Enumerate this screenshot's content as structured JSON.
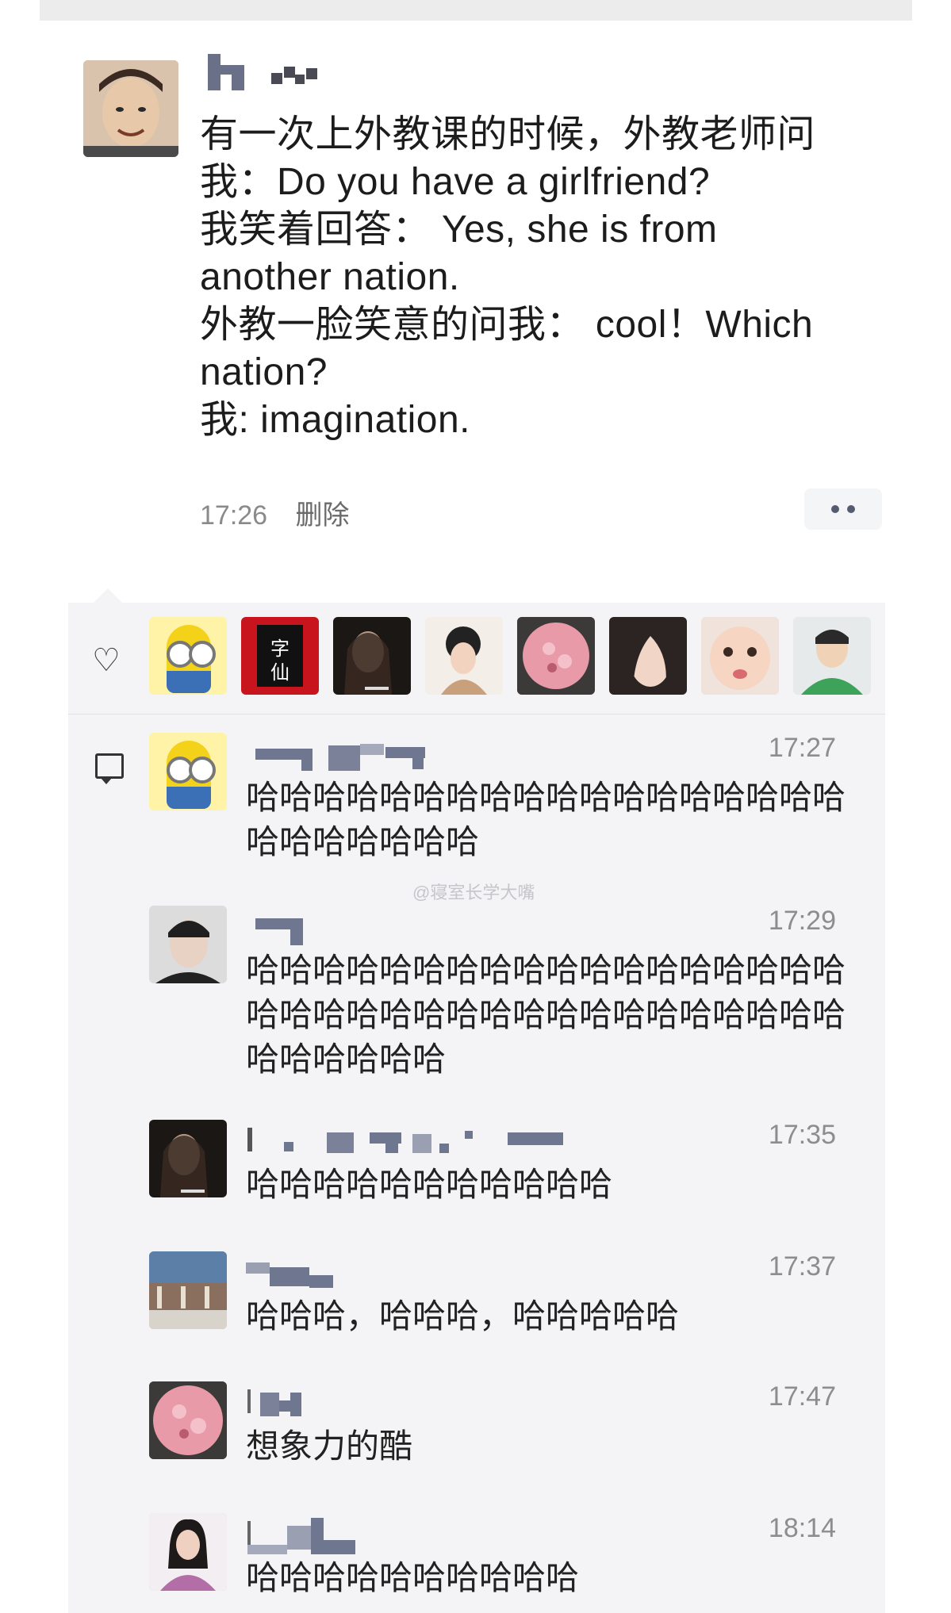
{
  "post": {
    "lines": [
      "有一次上外教课的时候，外教老师问",
      "我：Do you have a girlfriend?",
      "我笑着回答： Yes, she is from",
      "another nation.",
      "外教一脸笑意的问我： cool！Which",
      "nation?",
      "我: imagination."
    ],
    "time": "17:26",
    "delete_label": "删除"
  },
  "likes": {
    "icon": "heart-icon",
    "count_avatars": 8
  },
  "watermark": "@寝室长学大嘴",
  "comments": [
    {
      "time": "17:27",
      "text": "哈哈哈哈哈哈哈哈哈哈哈哈哈哈哈哈哈哈哈哈哈哈哈哈哈"
    },
    {
      "time": "17:29",
      "text": "哈哈哈哈哈哈哈哈哈哈哈哈哈哈哈哈哈哈哈哈哈哈哈哈哈哈哈哈哈哈哈哈哈哈哈哈哈哈哈哈哈哈"
    },
    {
      "time": "17:35",
      "text": "哈哈哈哈哈哈哈哈哈哈哈"
    },
    {
      "time": "17:37",
      "text": "哈哈哈，哈哈哈，哈哈哈哈哈"
    },
    {
      "time": "17:47",
      "text": "想象力的酷"
    },
    {
      "time": "18:14",
      "text": "哈哈哈哈哈哈哈哈哈哈"
    }
  ],
  "colors": {
    "panel": "#f4f4f6",
    "time": "#8d8d8d",
    "pixel": "#6f7690"
  }
}
